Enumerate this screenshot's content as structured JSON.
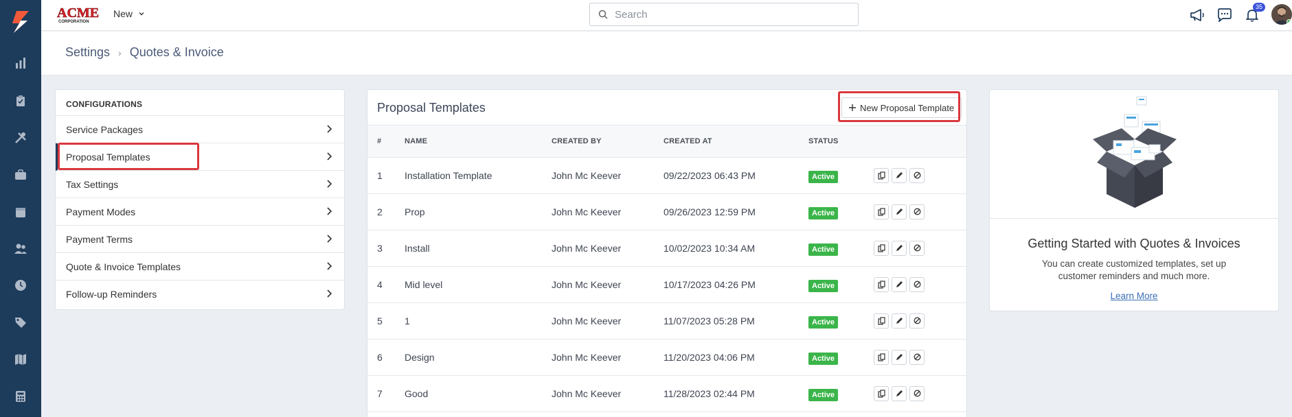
{
  "topbar": {
    "brand_text": "ACME CORPORATION",
    "new_label": "New",
    "search_placeholder": "Search",
    "notification_count": "35"
  },
  "breadcrumb": {
    "root": "Settings",
    "current": "Quotes & Invoice"
  },
  "configurations": {
    "heading": "CONFIGURATIONS",
    "items": [
      {
        "label": "Service Packages"
      },
      {
        "label": "Proposal Templates"
      },
      {
        "label": "Tax Settings"
      },
      {
        "label": "Payment Modes"
      },
      {
        "label": "Payment Terms"
      },
      {
        "label": "Quote & Invoice Templates"
      },
      {
        "label": "Follow-up Reminders"
      }
    ]
  },
  "templates": {
    "title": "Proposal Templates",
    "new_button": "New Proposal Template",
    "columns": [
      "#",
      "NAME",
      "CREATED BY",
      "CREATED AT",
      "STATUS"
    ],
    "rows": [
      {
        "num": "1",
        "name": "Installation Template",
        "created_by": "John Mc Keever",
        "created_at": "09/22/2023 06:43 PM",
        "status": "Active"
      },
      {
        "num": "2",
        "name": "Prop",
        "created_by": "John Mc Keever",
        "created_at": "09/26/2023 12:59 PM",
        "status": "Active"
      },
      {
        "num": "3",
        "name": "Install",
        "created_by": "John Mc Keever",
        "created_at": "10/02/2023 10:34 AM",
        "status": "Active"
      },
      {
        "num": "4",
        "name": "Mid level",
        "created_by": "John Mc Keever",
        "created_at": "10/17/2023 04:26 PM",
        "status": "Active"
      },
      {
        "num": "5",
        "name": "1",
        "created_by": "John Mc Keever",
        "created_at": "11/07/2023 05:28 PM",
        "status": "Active"
      },
      {
        "num": "6",
        "name": "Design",
        "created_by": "John Mc Keever",
        "created_at": "11/20/2023 04:06 PM",
        "status": "Active"
      },
      {
        "num": "7",
        "name": "Good",
        "created_by": "John Mc Keever",
        "created_at": "11/28/2023 02:44 PM",
        "status": "Active"
      }
    ]
  },
  "getting_started": {
    "title": "Getting Started with Quotes & Invoices",
    "description": "You can create customized templates, set up customer reminders and much more.",
    "link": "Learn More"
  },
  "colors": {
    "sidebar": "#1d3b5a",
    "status_active": "#3bb54a",
    "highlight": "#d9383e",
    "accent": "#3b52d9"
  }
}
